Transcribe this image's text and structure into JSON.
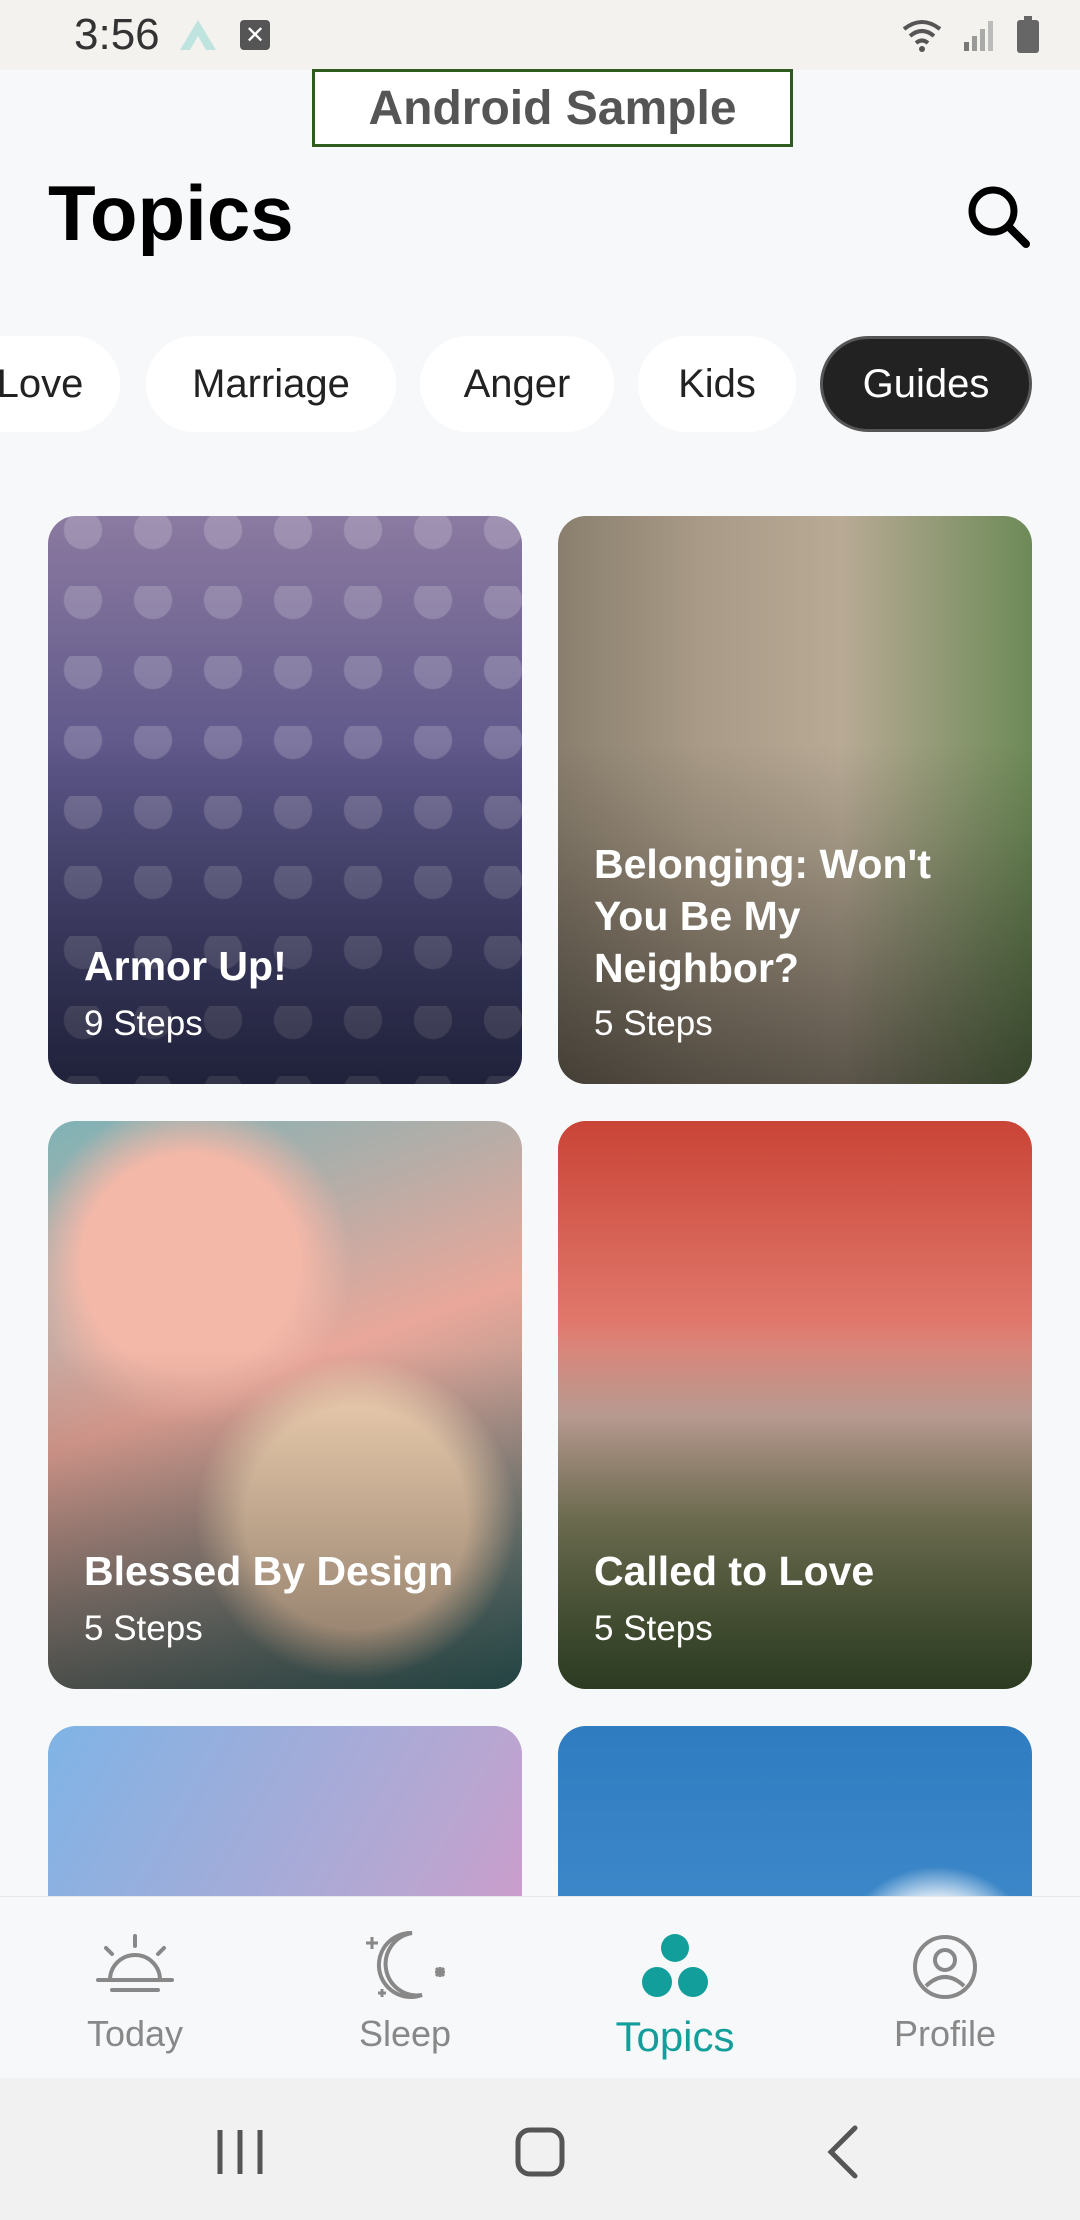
{
  "status_bar": {
    "time": "3:56",
    "icons": [
      "app-notification-icon",
      "close-notification-icon",
      "wifi-icon",
      "signal-icon",
      "battery-icon"
    ]
  },
  "banner": {
    "label": "Android Sample"
  },
  "header": {
    "title": "Topics",
    "search_icon": "search-icon"
  },
  "chips": [
    {
      "label": "Love",
      "active": false
    },
    {
      "label": "Marriage",
      "active": false
    },
    {
      "label": "Anger",
      "active": false
    },
    {
      "label": "Kids",
      "active": false
    },
    {
      "label": "Guides",
      "active": true
    }
  ],
  "cards": [
    {
      "title": "Armor Up!",
      "steps": "9 Steps"
    },
    {
      "title": "Belonging: Won't You Be My Neighbor?",
      "steps": "5 Steps"
    },
    {
      "title": "Blessed By Design",
      "steps": "5 Steps"
    },
    {
      "title": "Called to Love",
      "steps": "5 Steps"
    }
  ],
  "bottom_nav": [
    {
      "label": "Today",
      "icon": "sunrise-icon",
      "active": false
    },
    {
      "label": "Sleep",
      "icon": "moon-icon",
      "active": false
    },
    {
      "label": "Topics",
      "icon": "topics-icon",
      "active": true
    },
    {
      "label": "Profile",
      "icon": "profile-icon",
      "active": false
    }
  ],
  "colors": {
    "accent": "#129e9a",
    "chip_active_bg": "#222222",
    "background": "#f7f8fa"
  },
  "system_nav": {
    "icons": [
      "recent-apps-icon",
      "home-icon",
      "back-icon"
    ]
  }
}
